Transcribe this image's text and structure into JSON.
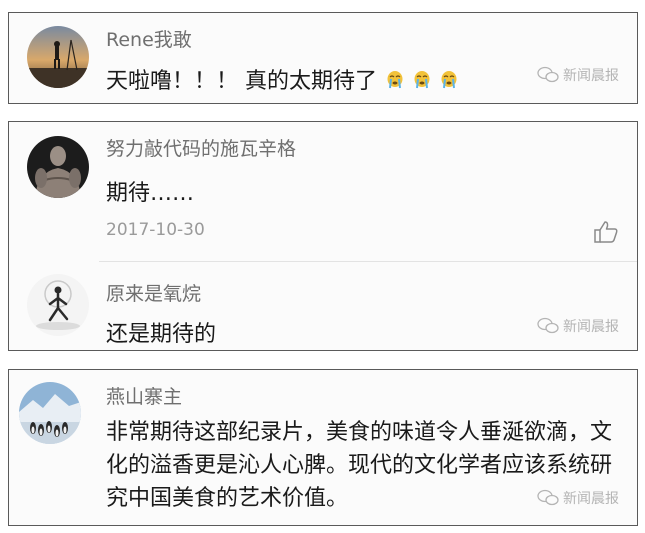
{
  "comments": [
    {
      "username": "Rene我敢",
      "text": "天啦噜！！！ 真的太期待了",
      "emoji_count": 3,
      "watermark": "新闻晨报"
    },
    {
      "username": "努力敲代码的施瓦辛格",
      "text": "期待……",
      "date": "2017-10-30",
      "reply": {
        "username": "原来是氧烷",
        "text": "还是期待的",
        "watermark": "新闻晨报"
      }
    },
    {
      "username": "燕山寨主",
      "text": "非常期待这部纪录片，美食的味道令人垂涎欲滴，文化的溢香更是沁人心脾。现代的文化学者应该系统研究中国美食的艺术价值。",
      "watermark": "新闻晨报"
    }
  ],
  "icons": {
    "like": "thumbs-up-icon",
    "watermark": "wechat-logo-icon",
    "emoji": "crying-emoji-icon"
  }
}
